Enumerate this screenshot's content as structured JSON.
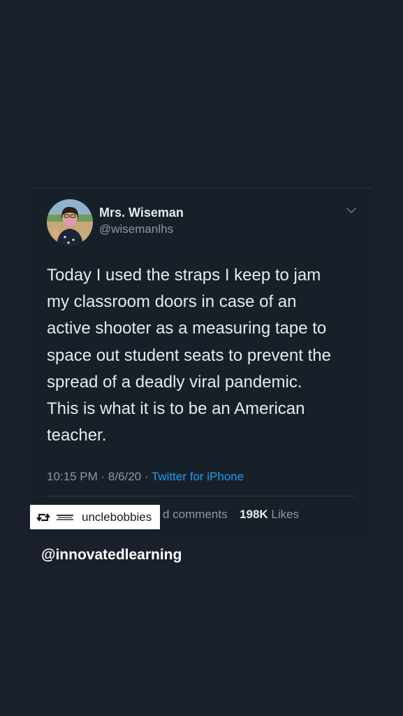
{
  "tweet": {
    "display_name": "Mrs. Wiseman",
    "handle": "@wisemanlhs",
    "text": "Today I used the straps I keep to jam\nmy classroom doors in case of an\nactive shooter as a measuring tape to\nspace out student seats to prevent the\nspread of a deadly viral pandemic.\nThis is what it is to be an American\nteacher.",
    "time_date": "10:15 PM · 8/6/20 · ",
    "source": "Twitter for iPhone",
    "comments_partial": "d comments",
    "likes_count": "198K",
    "likes_label": " Likes"
  },
  "repost": {
    "username": "unclebobbies",
    "icon": "repost-icon"
  },
  "footer": {
    "handle": "@innovatedlearning"
  },
  "colors": {
    "background": "#1a1f2c",
    "card": "#172029",
    "link": "#1d9bf0",
    "muted": "#8b98a5"
  }
}
